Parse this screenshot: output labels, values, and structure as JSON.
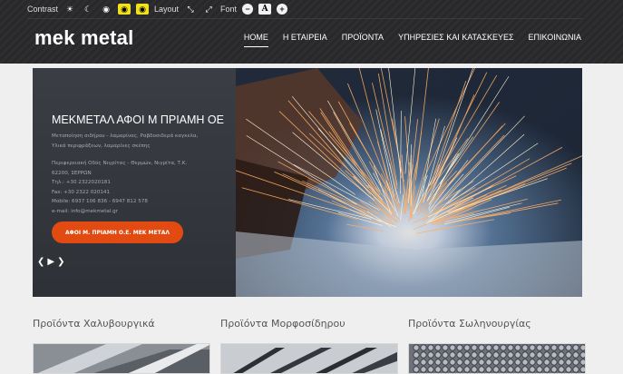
{
  "accessibility": {
    "contrast_label": "Contrast",
    "layout_label": "Layout",
    "font_label": "Font",
    "font_button_text": "A"
  },
  "header": {
    "logo": "mek metal",
    "nav": [
      {
        "label": "HOME",
        "active": true
      },
      {
        "label": "Η ΕΤΑΙΡΕΙΑ",
        "active": false
      },
      {
        "label": "ΠΡΟΪΟΝΤΑ",
        "active": false
      },
      {
        "label": "ΥΠΗΡΕΣΙΕΣ ΚΑΙ ΚΑΤΑΣΚΕΥΕΣ",
        "active": false
      },
      {
        "label": "ΕΠΙΚΟΙΝΩΝΙΑ",
        "active": false
      }
    ]
  },
  "hero": {
    "title": "ΜΕΚΜΕΤΑΛ ΑΦΟΙ Μ ΠΡΙΑΜΗ ΟΕ",
    "desc1": "Μεταποίηση σιδήρου - λαμαρίνας, Ραβδοσιδερά καγκελα,",
    "desc2": "Υλικά περιφράξεων, λαμαρίνες σκέπης",
    "address1": "Περιφερειακή Οδός Νιγρίτας - Θερμών, Νιγρίτα, Τ.Κ.",
    "address2": "62200, ΣΕΡΡΩΝ",
    "phone": "Τηλ.: +30 2322020181",
    "fax": "Fax: +30 2322 020141",
    "mobile": "Mobile: 6937 106 836 - 6947 812 578",
    "email": "e-mail: info@mekmetal.gr",
    "button": "ΑΦΟΙ Μ. ΠΡΙΑΜΗ Ο.Ε. ΜΕΚ ΜΕΤΑΛ",
    "prev_arrow": "❮",
    "next_arrow": "❯",
    "play_icon": "▶"
  },
  "sections": [
    {
      "title": "Προϊόντα Χαλυβουργικά"
    },
    {
      "title": "Προϊόντα Μορφοσίδηρου"
    },
    {
      "title": "Προϊόντα Σωληνουργίας"
    }
  ],
  "colors": {
    "header_bg": "#2b2b2d",
    "accent": "#e14a10",
    "contrast_yellow": "#f2e21b"
  }
}
